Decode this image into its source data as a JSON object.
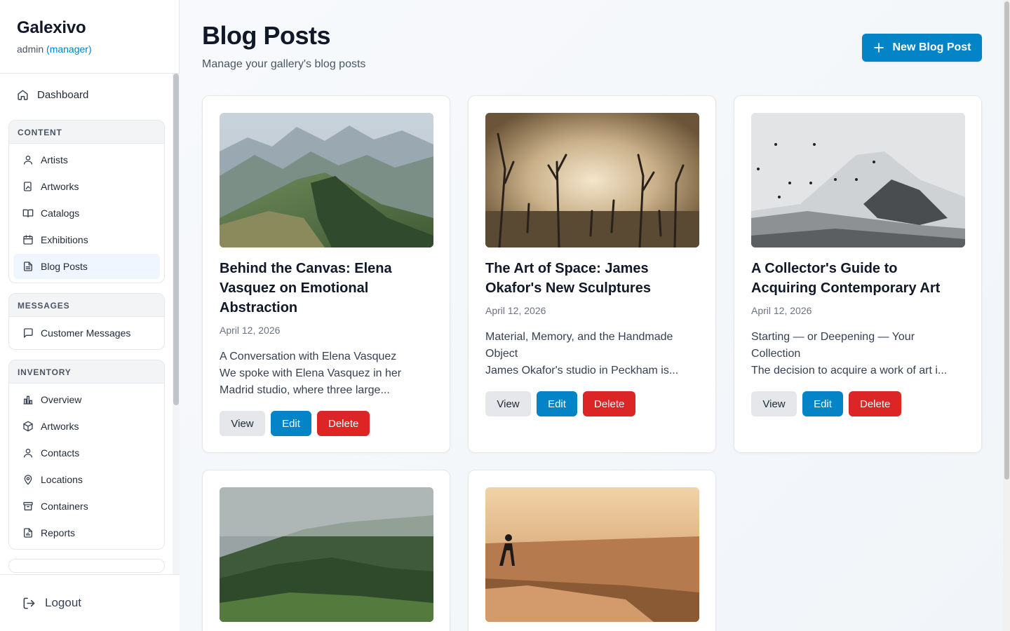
{
  "brand": {
    "name": "Galexivo",
    "user": "admin",
    "role": "(manager)"
  },
  "nav": {
    "dashboard": "Dashboard",
    "groups": [
      {
        "title": "CONTENT",
        "items": [
          "Artists",
          "Artworks",
          "Catalogs",
          "Exhibitions",
          "Blog Posts"
        ]
      },
      {
        "title": "MESSAGES",
        "items": [
          "Customer Messages"
        ]
      },
      {
        "title": "INVENTORY",
        "items": [
          "Overview",
          "Artworks",
          "Contacts",
          "Locations",
          "Containers",
          "Reports"
        ]
      }
    ],
    "active": "Blog Posts",
    "logout": "Logout"
  },
  "header": {
    "title": "Blog Posts",
    "subtitle": "Manage your gallery's blog posts",
    "new_button": "New Blog Post"
  },
  "posts": [
    {
      "title": "Behind the Canvas: Elena Vasquez on Emotional Abstraction",
      "date": "April 12, 2026",
      "excerpt_lines": [
        "A Conversation with Elena Vasquez",
        "We spoke with Elena Vasquez in her",
        "Madrid studio, where three large..."
      ],
      "image": "mountain-ridge-photo"
    },
    {
      "title": "The Art of Space: James Okafor's New Sculptures",
      "date": "April 12, 2026",
      "excerpt_lines": [
        "Material, Memory, and the Handmade",
        "Object",
        "James Okafor's studio in Peckham is..."
      ],
      "image": "misty-dead-trees-photo"
    },
    {
      "title": "A Collector's Guide to Acquiring Contemporary Art",
      "date": "April 12, 2026",
      "excerpt_lines": [
        "Starting — or Deepening — Your",
        "Collection",
        "The decision to acquire a work of art i..."
      ],
      "image": "snowy-mountain-birds-photo"
    },
    {
      "image": "foggy-forest-hill-photo"
    },
    {
      "image": "sunset-sea-fisherman-photo"
    }
  ],
  "buttons": {
    "view": "View",
    "edit": "Edit",
    "delete": "Delete"
  },
  "colors": {
    "accent": "#0284c7",
    "danger": "#dc2626",
    "neutral_button": "#e5e7eb",
    "active_nav": "#eff6ff"
  }
}
